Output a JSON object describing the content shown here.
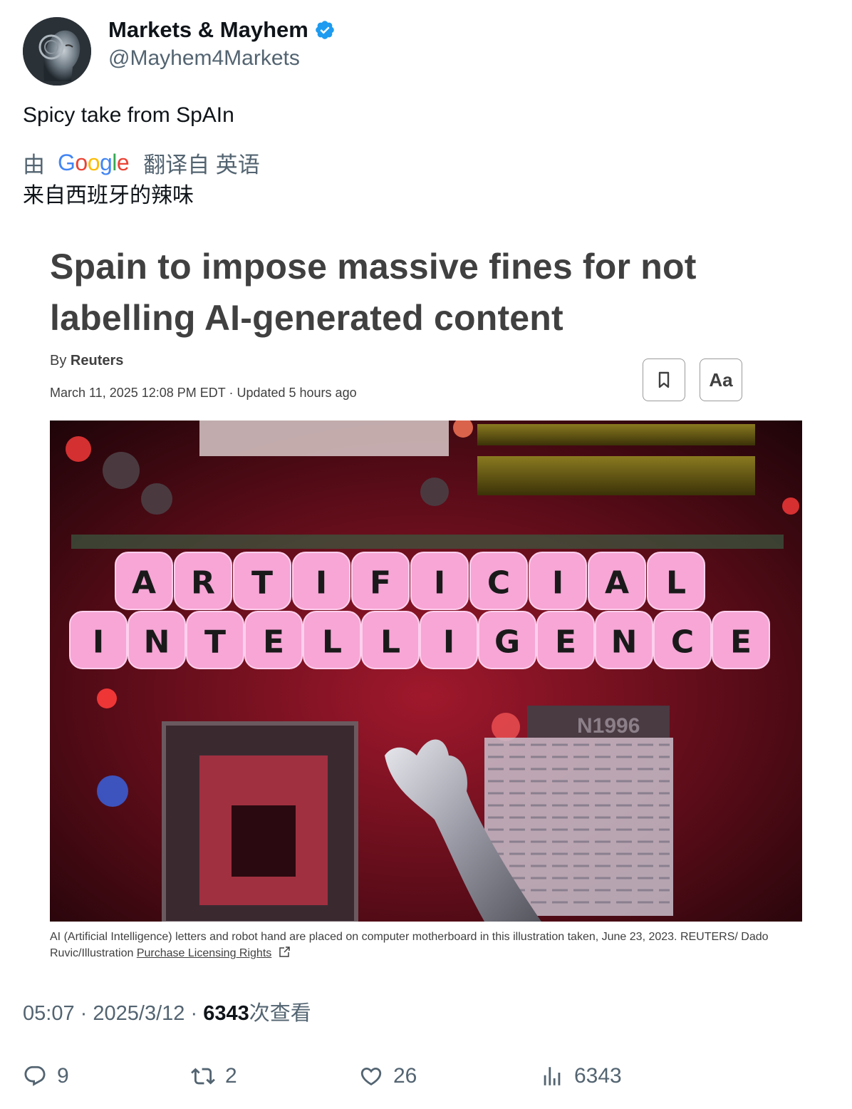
{
  "author": {
    "display_name": "Markets & Mayhem",
    "handle": "@Mayhem4Markets",
    "verified": true
  },
  "tweet": {
    "text": "Spicy take from SpAIn",
    "translation": {
      "by": "由",
      "provider": "Google",
      "from_language": "翻译自 英语",
      "translated_text": "来自西班牙的辣味"
    }
  },
  "article": {
    "headline": "Spain to impose massive fines for not labelling AI-generated content",
    "by_prefix": "By",
    "source": "Reuters",
    "dateline": "March 11, 2025 12:08 PM EDT · Updated 5 hours ago",
    "font_button_label": "Aa",
    "image": {
      "row1": "ARTIFICIAL",
      "row2": "INTELLIGENCE",
      "chip_text": "N1996"
    },
    "caption": "AI (Artificial Intelligence) letters and robot hand are placed on computer motherboard in this illustration taken, June 23, 2023. REUTERS/ Dado Ruvic/Illustration",
    "caption_link": "Purchase Licensing Rights"
  },
  "meta": {
    "time": "05:07",
    "separator": "·",
    "date": "2025/3/12",
    "views": "6343",
    "views_label": "次查看"
  },
  "actions": {
    "replies": "9",
    "reposts": "2",
    "likes": "26",
    "views": "6343"
  },
  "colors": {
    "verified": "#1d9bf0",
    "secondary_text": "#536471",
    "primary_text": "#0f1419",
    "article_text": "#404040"
  },
  "icons": [
    "verified-icon",
    "bookmark-icon",
    "external-link-icon",
    "reply-icon",
    "repost-icon",
    "like-icon",
    "views-icon"
  ]
}
